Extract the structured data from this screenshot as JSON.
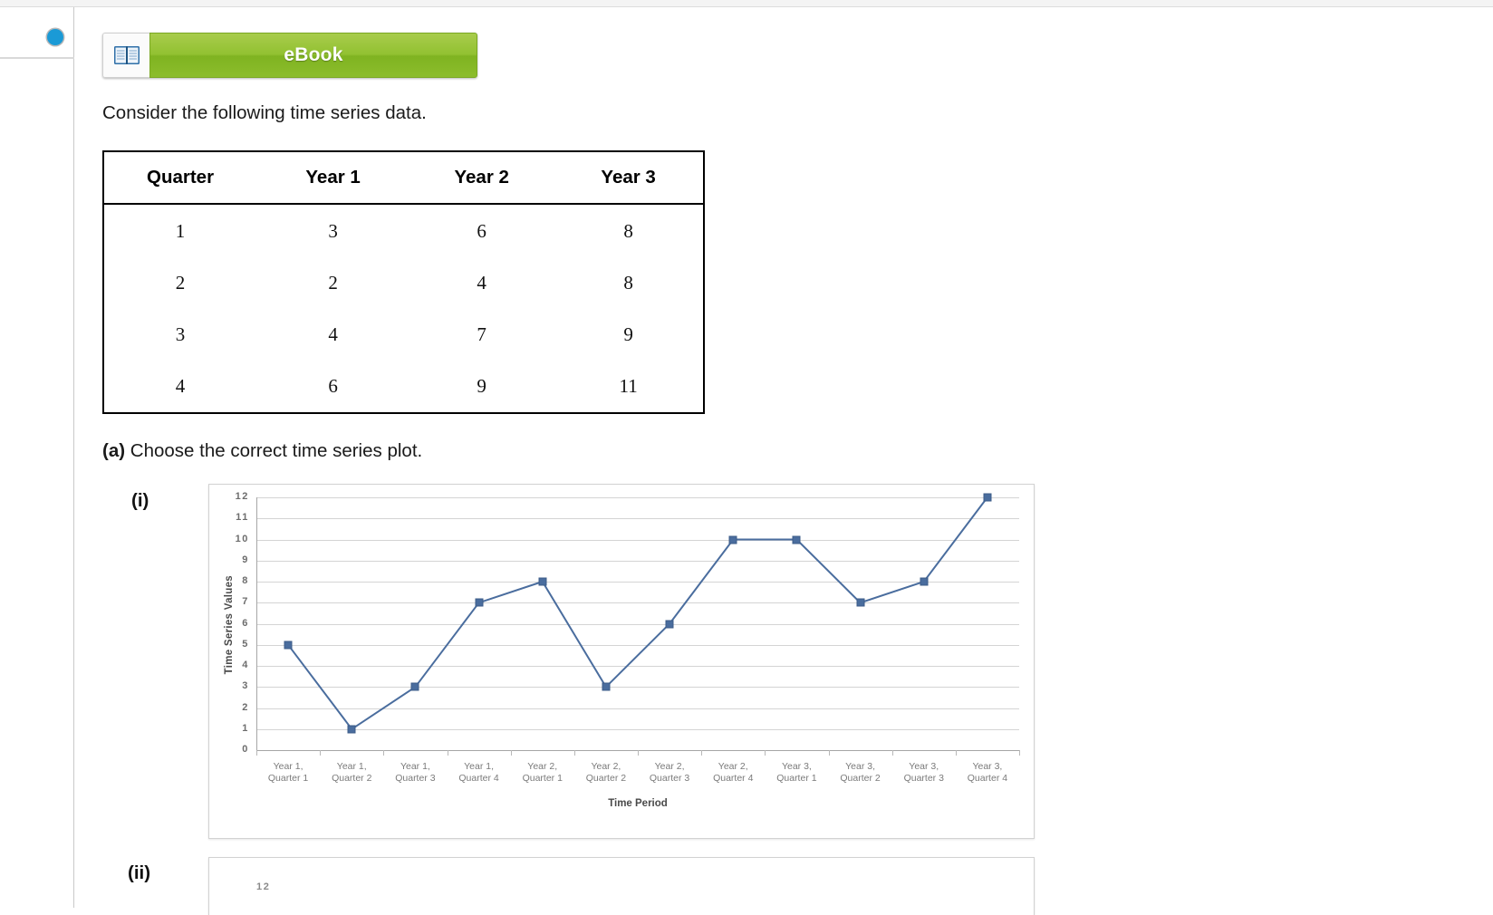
{
  "sidebar": {
    "progress_indicator": "current-step-dot"
  },
  "toolbar": {
    "ebook_label": "eBook",
    "ebook_icon": "book-icon",
    "ebook_color": "#8cbd2c"
  },
  "prompt": "Consider the following time series data.",
  "table": {
    "headers": [
      "Quarter",
      "Year 1",
      "Year 2",
      "Year 3"
    ],
    "rows": [
      [
        "1",
        "3",
        "6",
        "8"
      ],
      [
        "2",
        "2",
        "4",
        "8"
      ],
      [
        "3",
        "4",
        "7",
        "9"
      ],
      [
        "4",
        "6",
        "9",
        "11"
      ]
    ]
  },
  "questions": {
    "a": {
      "label": "(a)",
      "text": "Choose the correct time series plot.",
      "options": [
        {
          "label": "(i)"
        },
        {
          "label": "(ii)"
        }
      ]
    }
  },
  "chart_data": {
    "type": "line",
    "title": "",
    "xlabel": "Time Period",
    "ylabel": "Time Series Values",
    "ylim": [
      0,
      12
    ],
    "yticks": [
      "0",
      "1",
      "2",
      "3",
      "4",
      "5",
      "6",
      "7",
      "8",
      "9",
      "10",
      "11",
      "12"
    ],
    "grid": true,
    "legend": "none",
    "marker_color": "#4a6d9e",
    "line_color": "#4a6d9e",
    "categories": [
      "Year 1,\nQuarter 1",
      "Year 1,\nQuarter 2",
      "Year 1,\nQuarter 3",
      "Year 1,\nQuarter 4",
      "Year 2,\nQuarter 1",
      "Year 2,\nQuarter 2",
      "Year 2,\nQuarter 3",
      "Year 2,\nQuarter 4",
      "Year 3,\nQuarter 1",
      "Year 3,\nQuarter 2",
      "Year 3,\nQuarter 3",
      "Year 3,\nQuarter 4"
    ],
    "category_lines": [
      [
        "Year 1,",
        "Quarter 1"
      ],
      [
        "Year 1,",
        "Quarter 2"
      ],
      [
        "Year 1,",
        "Quarter 3"
      ],
      [
        "Year 1,",
        "Quarter 4"
      ],
      [
        "Year 2,",
        "Quarter 1"
      ],
      [
        "Year 2,",
        "Quarter 2"
      ],
      [
        "Year 2,",
        "Quarter 3"
      ],
      [
        "Year 2,",
        "Quarter 4"
      ],
      [
        "Year 3,",
        "Quarter 1"
      ],
      [
        "Year 3,",
        "Quarter 2"
      ],
      [
        "Year 3,",
        "Quarter 3"
      ],
      [
        "Year 3,",
        "Quarter 4"
      ]
    ],
    "values": [
      5,
      1,
      3,
      7,
      8,
      3,
      6,
      10,
      10,
      7,
      8,
      12
    ]
  },
  "chart_peek_ii": {
    "first_ytick": "12"
  }
}
